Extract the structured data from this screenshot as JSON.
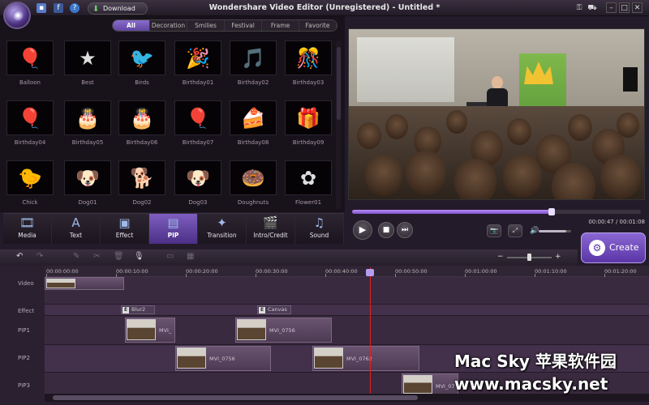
{
  "titlebar": {
    "download_label": "Download",
    "title": "Wondershare Video Editor (Unregistered) - Untitled *",
    "icons": [
      "save-icon",
      "facebook-icon",
      "help-icon",
      "key-icon",
      "cart-icon",
      "minimize-icon",
      "restore-icon",
      "close-icon"
    ]
  },
  "library": {
    "tabs": [
      {
        "label": "All",
        "active": true
      },
      {
        "label": "Decoration"
      },
      {
        "label": "Smilies"
      },
      {
        "label": "Festival"
      },
      {
        "label": "Frame"
      },
      {
        "label": "Favorite"
      }
    ],
    "items": [
      {
        "label": "Balloon",
        "glyph": "🎈"
      },
      {
        "label": "Best",
        "glyph": "★"
      },
      {
        "label": "Birds",
        "glyph": "🐦"
      },
      {
        "label": "Birthday01",
        "glyph": "🎉"
      },
      {
        "label": "Birthday02",
        "glyph": "🎵"
      },
      {
        "label": "Birthday03",
        "glyph": "🎊"
      },
      {
        "label": "Birthday04",
        "glyph": "🎈"
      },
      {
        "label": "Birthday05",
        "glyph": "🎂"
      },
      {
        "label": "Birthday06",
        "glyph": "🎂"
      },
      {
        "label": "Birthday07",
        "glyph": "🎈"
      },
      {
        "label": "Birthday08",
        "glyph": "🍰"
      },
      {
        "label": "Birthday09",
        "glyph": "🎁"
      },
      {
        "label": "Chick",
        "glyph": "🐤"
      },
      {
        "label": "Dog01",
        "glyph": "🐶"
      },
      {
        "label": "Dog02",
        "glyph": "🐕"
      },
      {
        "label": "Dog03",
        "glyph": "🐶"
      },
      {
        "label": "Doughnuts",
        "glyph": "🍩"
      },
      {
        "label": "Flower01",
        "glyph": "✿"
      }
    ]
  },
  "nav": [
    {
      "label": "Media",
      "icon": "🎞"
    },
    {
      "label": "Text",
      "icon": "A"
    },
    {
      "label": "Effect",
      "icon": "▣"
    },
    {
      "label": "PIP",
      "icon": "▤",
      "active": true
    },
    {
      "label": "Transition",
      "icon": "✦"
    },
    {
      "label": "Intro/Credit",
      "icon": "🎬"
    },
    {
      "label": "Sound",
      "icon": "♫"
    }
  ],
  "player": {
    "time": "00:00:47 / 00:01:08",
    "progress": 0.69,
    "volume": 0.85,
    "play_icon": "▶",
    "stop_icon": "■",
    "next_icon": "⏭",
    "snapshot_icon": "📷",
    "fullscreen_icon": "⤢",
    "volume_icon": "🔊"
  },
  "create": {
    "label": "Create",
    "icon": "⚙"
  },
  "timeline": {
    "ruler": [
      "00:00:00:00",
      "00:00:10:00",
      "00:00:20:00",
      "00:00:30:00",
      "00:00:40:00",
      "00:00:50:00",
      "00:01:00:00",
      "00:01:10:00",
      "00:01:20:00"
    ],
    "tracks": [
      "Video",
      "Effect",
      "PIP1",
      "PIP2",
      "PIP3"
    ],
    "effects": [
      "Blur2",
      "Canvas"
    ],
    "clips": {
      "pip1a": "MVI_",
      "pip1b": "MVI_0756",
      "pip2a": "MVI_0756",
      "pip2b": "MVI_0762",
      "pip3a": "MVI_07"
    },
    "zoom_minus": "−",
    "zoom_plus": "+",
    "zoom_level": 0.45
  },
  "watermark": {
    "line1": "Mac Sky 苹果软件园",
    "line2": "www.macsky.net"
  }
}
